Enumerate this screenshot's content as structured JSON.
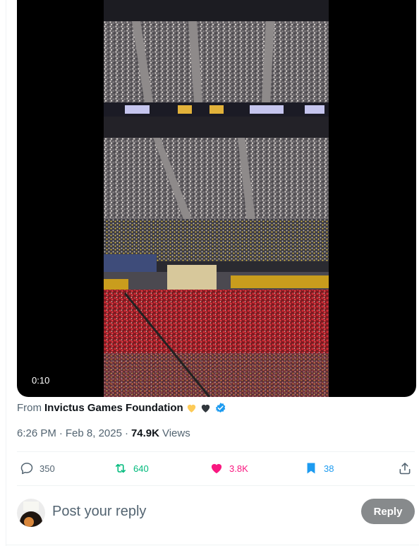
{
  "video": {
    "timestamp": "0:10"
  },
  "source": {
    "prefix": "From",
    "account": "Invictus Games Foundation",
    "emojis": [
      "yellow-heart",
      "black-heart"
    ],
    "verified": true
  },
  "meta": {
    "time": "6:26 PM",
    "separator": "·",
    "date": "Feb 8, 2025",
    "views_count": "74.9K",
    "views_label": "Views"
  },
  "actions": {
    "replies": "350",
    "reposts": "640",
    "likes": "3.8K",
    "bookmarks": "38"
  },
  "reply": {
    "placeholder": "Post your reply",
    "button_label": "Reply"
  },
  "colors": {
    "repost": "#00ba7c",
    "like": "#f91880",
    "bookmark": "#1d9bf0",
    "verified": "#1d9bf0",
    "reply_button": "#878a8c"
  }
}
